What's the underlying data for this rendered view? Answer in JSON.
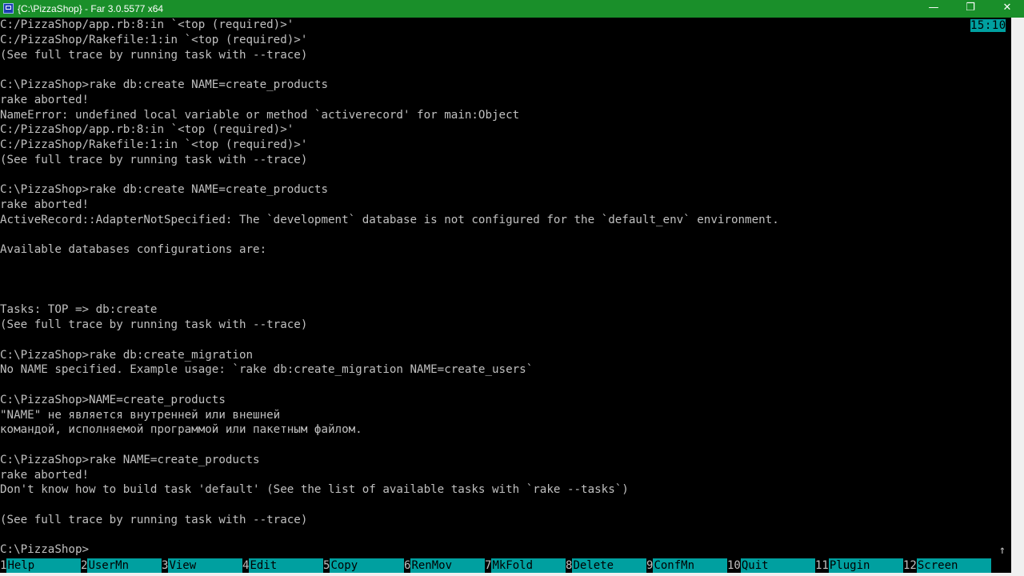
{
  "window": {
    "title": "{C:\\PizzaShop} - Far 3.0.5577 x64",
    "buttons": {
      "minimize": "—",
      "restore": "❐",
      "close": "✕"
    }
  },
  "clock": "15:10",
  "console_lines": [
    "C:/PizzaShop/app.rb:8:in `<top (required)>'",
    "C:/PizzaShop/Rakefile:1:in `<top (required)>'",
    "(See full trace by running task with --trace)",
    "",
    "C:\\PizzaShop>rake db:create NAME=create_products",
    "rake aborted!",
    "NameError: undefined local variable or method `activerecord' for main:Object",
    "C:/PizzaShop/app.rb:8:in `<top (required)>'",
    "C:/PizzaShop/Rakefile:1:in `<top (required)>'",
    "(See full trace by running task with --trace)",
    "",
    "C:\\PizzaShop>rake db:create NAME=create_products",
    "rake aborted!",
    "ActiveRecord::AdapterNotSpecified: The `development` database is not configured for the `default_env` environment.",
    "",
    "Available databases configurations are:",
    "",
    "",
    "",
    "Tasks: TOP => db:create",
    "(See full trace by running task with --trace)",
    "",
    "C:\\PizzaShop>rake db:create_migration",
    "No NAME specified. Example usage: `rake db:create_migration NAME=create_users`",
    "",
    "C:\\PizzaShop>NAME=create_products",
    "\"NAME\" не является внутренней или внешней",
    "командой, исполняемой программой или пакетным файлом.",
    "",
    "C:\\PizzaShop>rake NAME=create_products",
    "rake aborted!",
    "Don't know how to build task 'default' (See the list of available tasks with `rake --tasks`)",
    "",
    "(See full trace by running task with --trace)",
    "",
    "C:\\PizzaShop>"
  ],
  "scroll_up_arrow": "↑",
  "keybar": [
    {
      "num": "1",
      "label": "Help"
    },
    {
      "num": "2",
      "label": "UserMn"
    },
    {
      "num": "3",
      "label": "View"
    },
    {
      "num": "4",
      "label": "Edit"
    },
    {
      "num": "5",
      "label": "Copy"
    },
    {
      "num": "6",
      "label": "RenMov"
    },
    {
      "num": "7",
      "label": "MkFold"
    },
    {
      "num": "8",
      "label": "Delete"
    },
    {
      "num": "9",
      "label": "ConfMn"
    },
    {
      "num": "10",
      "label": "Quit"
    },
    {
      "num": "11",
      "label": "Plugin"
    },
    {
      "num": "12",
      "label": "Screen"
    }
  ],
  "colors": {
    "titlebar": "#1a8f2a",
    "console_bg": "#000000",
    "console_text": "#c0c0c0",
    "keybar_label_bg": "#00a0a0",
    "clock_bg": "#00a0a0"
  }
}
